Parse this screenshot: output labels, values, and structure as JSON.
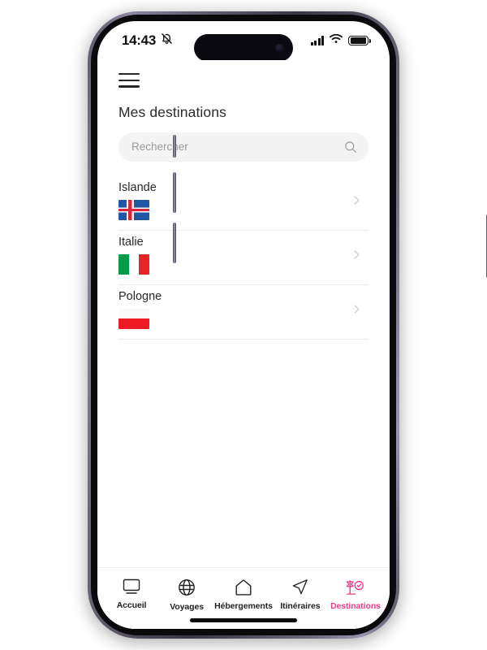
{
  "status_bar": {
    "time": "14:43",
    "silent_icon": "bell-slash-icon",
    "signal_icon": "cellular-signal-icon",
    "wifi_icon": "wifi-icon",
    "battery_icon": "battery-icon"
  },
  "header": {
    "menu_icon": "hamburger-menu-icon",
    "title": "Mes destinations"
  },
  "search": {
    "placeholder": "Rechercher",
    "value": "",
    "icon": "search-icon"
  },
  "destinations": [
    {
      "name": "Islande",
      "flag": "flag-iceland",
      "chevron": "chevron-right-icon"
    },
    {
      "name": "Italie",
      "flag": "flag-italy",
      "chevron": "chevron-right-icon"
    },
    {
      "name": "Pologne",
      "flag": "flag-poland",
      "chevron": "chevron-right-icon"
    }
  ],
  "tabbar": {
    "items": [
      {
        "label": "Accueil",
        "icon": "monitor-icon",
        "active": false
      },
      {
        "label": "Voyages",
        "icon": "globe-icon",
        "active": false
      },
      {
        "label": "Hébergements",
        "icon": "house-icon",
        "active": false
      },
      {
        "label": "Itinéraires",
        "icon": "paper-plane-icon",
        "active": false
      },
      {
        "label": "Destinations",
        "icon": "flag-check-icon",
        "active": true
      }
    ]
  },
  "colors": {
    "accent": "#f2398c",
    "text": "#222222",
    "muted": "#9a9a9a",
    "search_bg": "#f4f4f4",
    "divider": "#ededed"
  }
}
